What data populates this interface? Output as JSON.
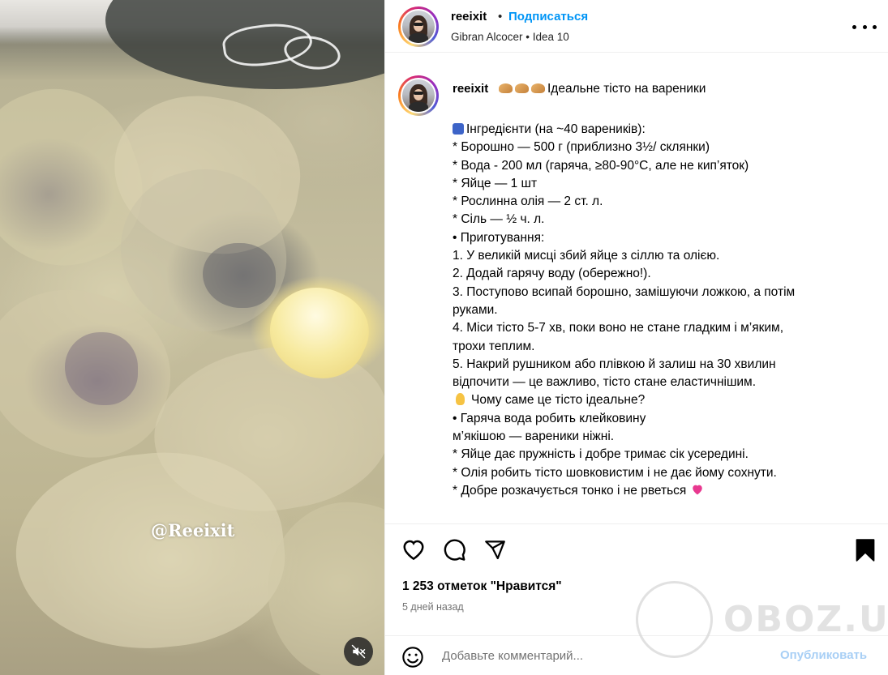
{
  "media": {
    "watermark_handle": "@Reeixit",
    "mute_icon": "speaker-muted-icon"
  },
  "header": {
    "username": "reeixit",
    "separator": "•",
    "follow_label": "Подписаться",
    "audio": "Gibran Alcocer • Idea 10",
    "more_icon": "more-horizontal-icon"
  },
  "caption": {
    "username": "reeixit",
    "title": "Ідеальне тісто на вареники",
    "lines": [
      "",
      "Інгредієнти (на ~40 вареників):",
      "* Борошно — 500 г (приблизно 3½/ склянки)",
      "* Вода - 200 мл (гаряча, ≥80-90°C, але не кип’яток)",
      "* Яйце — 1 шт",
      "* Рослинна олія — 2 ст. л.",
      "* Сіль — ½ ч. л.",
      "• Приготування:",
      "1. У великій мисці збий яйце з сіллю та олією.",
      "2. Додай гарячу воду (обережно!).",
      "3. Поступово всипай борошно, замішуючи ложкою, а потім",
      "руками.",
      "4. Міси тісто 5-7 хв, поки воно не стане гладким і м’яким,",
      "трохи теплим.",
      "5. Накрий рушником або плівкою й залиш на 30 хвилин",
      "відпочити — це важливо, тісто стане еластичнішим.",
      "Чому саме це тісто ідеальне?",
      "• Гаряча вода робить клейковину",
      "м’якішою — вареники ніжні.",
      "* Яйце дає пружність і добре тримає сік усередині.",
      "* Олія робить тісто шовковистим і не дає йому сохнути.",
      "* Добре розкачується тонко і не рветься"
    ]
  },
  "actions": {
    "like_icon": "heart-outline-icon",
    "comment_icon": "comment-icon",
    "share_icon": "share-icon",
    "save_icon": "bookmark-filled-icon",
    "likes": "1 253 отметок \"Нравится\"",
    "time": "5 дней назад"
  },
  "comment": {
    "emoji_icon": "emoji-icon",
    "placeholder": "Добавьте комментарий...",
    "publish_label": "Опубликовать"
  },
  "watermark": {
    "site": "OBOZ.UA"
  }
}
